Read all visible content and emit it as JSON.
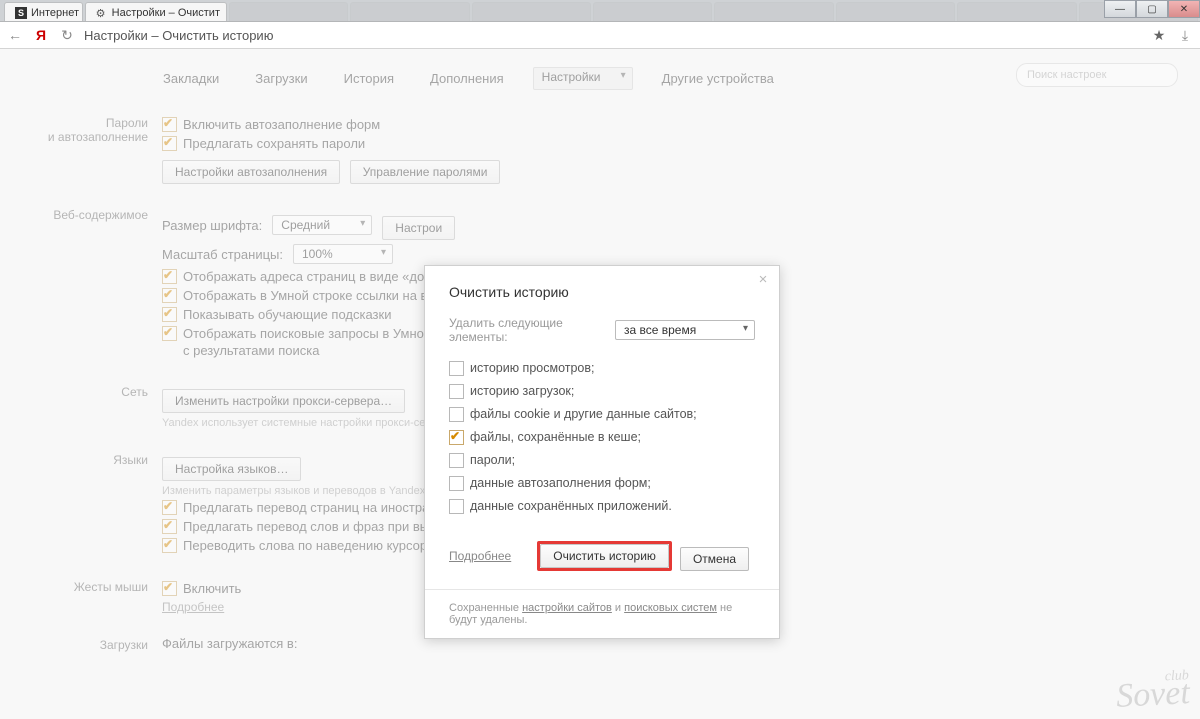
{
  "tabs": {
    "t0": "Интернет",
    "t1": "Настройки – Очистит"
  },
  "winbtns": {
    "min": "—",
    "max": "▢",
    "close": "✕"
  },
  "addr": {
    "text": "Настройки – Очистить историю"
  },
  "nav": {
    "bookmarks": "Закладки",
    "downloads": "Загрузки",
    "history": "История",
    "addons": "Дополнения",
    "settings": "Настройки",
    "other": "Другие устройства"
  },
  "search_placeholder": "Поиск настроек",
  "sections": {
    "passwords_label": "Пароли\nи автозаполнение",
    "passwords": {
      "autofill": "Включить автозаполнение форм",
      "savepw": "Предлагать сохранять пароли",
      "btn_autofill": "Настройки автозаполнения",
      "btn_pwmanage": "Управление паролями"
    },
    "web_label": "Веб-содержимое",
    "web": {
      "fontsize_label": "Размер шрифта:",
      "fontsize_value": "Средний",
      "btn_fonts": "Настрои",
      "zoom_label": "Масштаб страницы:",
      "zoom_value": "100%",
      "ck1": "Отображать адреса страниц в виде «домен > за",
      "ck2": "Отображать в Умной строке ссылки на важные р",
      "ck3": "Показывать обучающие подсказки",
      "ck4": "Отображать поисковые запросы в Умной строке\nс результатами поиска"
    },
    "net_label": "Сеть",
    "net": {
      "btn_proxy": "Изменить настройки прокси-сервера…",
      "hint": "Yandex использует системные настройки прокси-сервера."
    },
    "lang_label": "Языки",
    "lang": {
      "btn_lang": "Настройка языков…",
      "hint": "Изменить параметры языков и переводов в Yandex. Подро",
      "ck1": "Предлагать перевод страниц на иностранном яз",
      "ck2": "Предлагать перевод слов и фраз при выделении текста",
      "ck3": "Переводить слова по наведению курсора и нажатию кнопки Shift"
    },
    "mouse_label": "Жесты мыши",
    "mouse": {
      "ck": "Включить",
      "link": "Подробнее"
    },
    "dl_label": "Загрузки",
    "dl_text": "Файлы загружаются в:"
  },
  "dialog": {
    "title": "Очистить историю",
    "del_label": "Удалить следующие элементы:",
    "del_value": "за все время",
    "ck1": "историю просмотров;",
    "ck2": "историю загрузок;",
    "ck3": "файлы cookie и другие данные сайтов;",
    "ck4": "файлы, сохранённые в кеше;",
    "ck5": "пароли;",
    "ck6": "данные автозаполнения форм;",
    "ck7": "данные сохранённых приложений.",
    "more": "Подробнее",
    "clear": "Очистить историю",
    "cancel": "Отмена",
    "foot_pre": "Сохраненные ",
    "foot_l1": "настройки сайтов",
    "foot_mid": " и ",
    "foot_l2": "поисковых систем",
    "foot_post": " не будут удалены."
  },
  "watermark": {
    "top": "club",
    "main": "Sovet"
  }
}
